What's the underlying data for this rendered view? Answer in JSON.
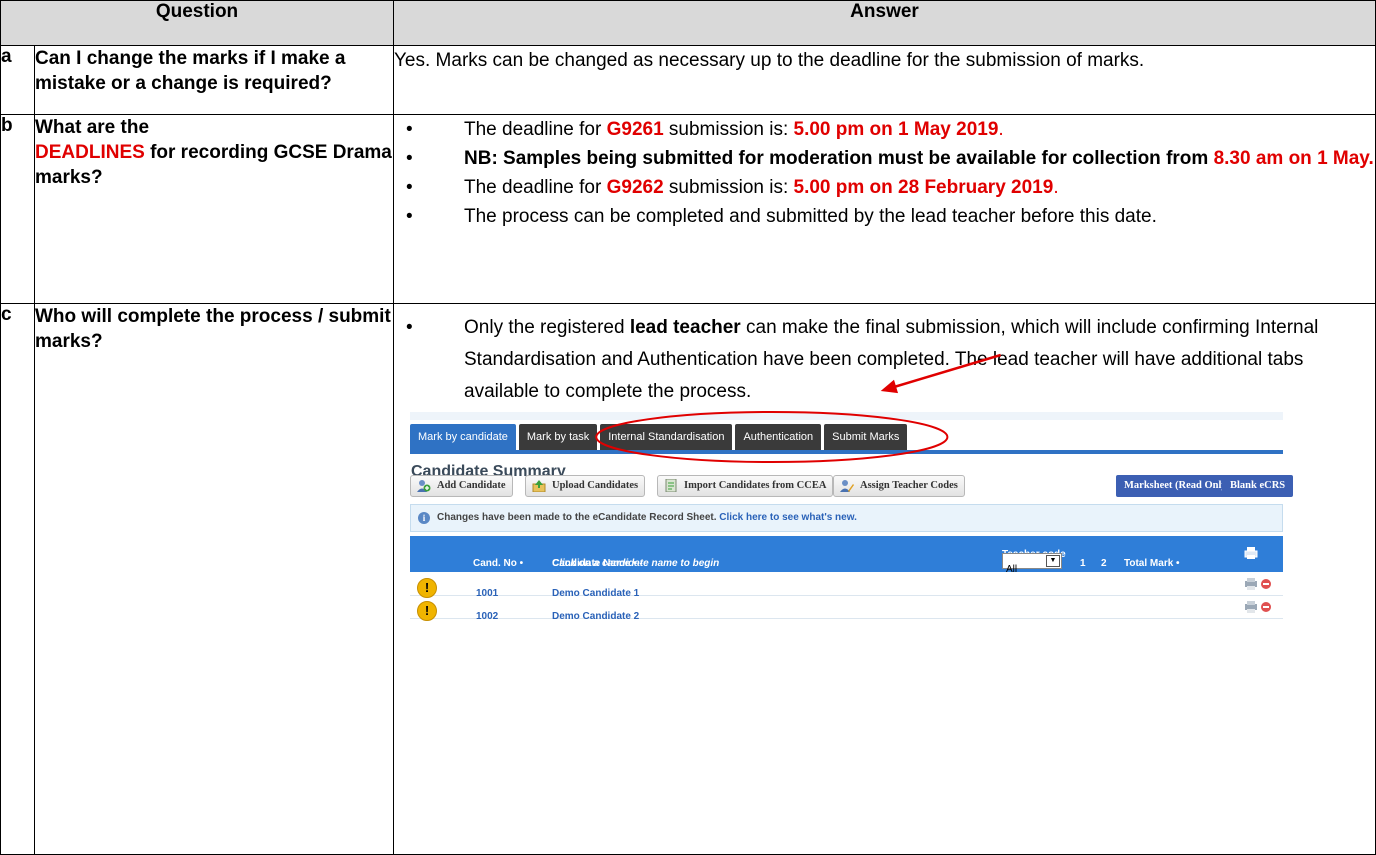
{
  "header": {
    "question": "Question",
    "answer": "Answer"
  },
  "rows": {
    "a": {
      "letter": "a",
      "question": "Can I change the marks if I make a mistake or a change is required?",
      "answer": "Yes. Marks can be changed as necessary up to the deadline for the submission of marks."
    },
    "b": {
      "letter": "b",
      "q_part1": "What are the",
      "q_red": "DEADLINES",
      "q_part2": " for recording GCSE Drama marks?",
      "bullet1": {
        "pre": "The deadline for ",
        "code": "G9261",
        "mid": " submission is:  ",
        "date": "5.00 pm on 1 May 2019",
        "post": "."
      },
      "bullet2": {
        "bold": "NB: Samples being submitted for moderation must be available for collection from ",
        "date": "8.30 am on 1 May."
      },
      "bullet3": {
        "pre": "The deadline for ",
        "code": "G9262",
        "mid": " submission is: ",
        "date": "5.00 pm on 28 February 2019",
        "post": "."
      },
      "bullet4": "The process can be completed and submitted by the lead teacher before this date."
    },
    "c": {
      "letter": "c",
      "question": "Who will complete the process / submit marks?",
      "pre": "Only the registered ",
      "bold": "lead teacher",
      "post": " can make the final submission, which will include confirming Internal Standardisation and Authentication have been completed.  The lead teacher will have additional tabs available to complete the process."
    }
  },
  "screenshot": {
    "tabs": [
      "Mark by candidate",
      "Mark by task",
      "Internal Standardisation",
      "Authentication",
      "Submit Marks"
    ],
    "title": "Candidate Summary",
    "buttons": [
      "Add Candidate",
      "Upload Candidates",
      "Import Candidates from CCEA",
      "Assign Teacher Codes"
    ],
    "blue_buttons": [
      "Marksheet (Read Only)",
      "Blank eCRS"
    ],
    "notice_text": "Changes have been made to the eCandidate Record Sheet. ",
    "notice_link": "Click here to see what's new.",
    "columns": {
      "cand_no": "Cand. No •",
      "name": "Candidate Name • - ",
      "name_hint": "Click on a candidate name to begin",
      "teacher_code": "Teacher code",
      "teacher_select": "All",
      "c1": "1",
      "c2": "2",
      "total": "Total Mark •"
    },
    "candidates": [
      {
        "no": "1001",
        "name": "Demo Candidate 1"
      },
      {
        "no": "1002",
        "name": "Demo Candidate 2"
      }
    ],
    "colors": {
      "tab_active": "#2f72c4",
      "tab": "#3a3a3a",
      "header": "#2f7ed8",
      "annotation": "#e00000"
    }
  }
}
